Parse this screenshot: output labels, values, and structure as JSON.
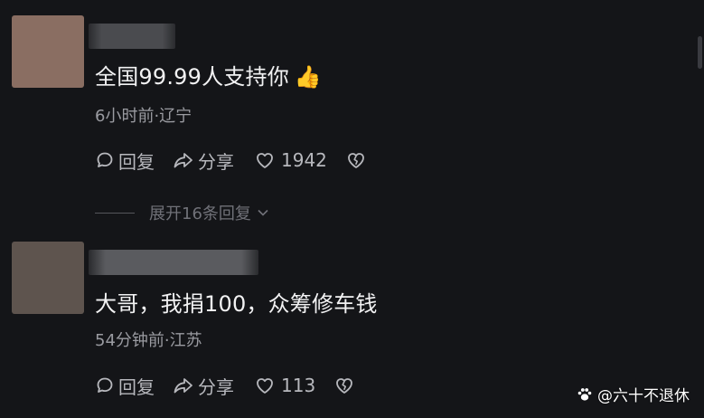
{
  "comments": [
    {
      "avatar_color": "#8a6e62",
      "content": "全国99.99人支持你",
      "emoji": "👍",
      "meta": "6小时前·辽宁",
      "reply_label": "回复",
      "share_label": "分享",
      "like_count": "1942",
      "expand_label": "展开16条回复"
    },
    {
      "avatar_color": "#5e544e",
      "content": "大哥，我捐100，众筹修车钱",
      "meta": "54分钟前·江苏",
      "reply_label": "回复",
      "share_label": "分享",
      "like_count": "113"
    }
  ],
  "watermark": {
    "icon": "paw-icon",
    "text": "@六十不退休"
  }
}
